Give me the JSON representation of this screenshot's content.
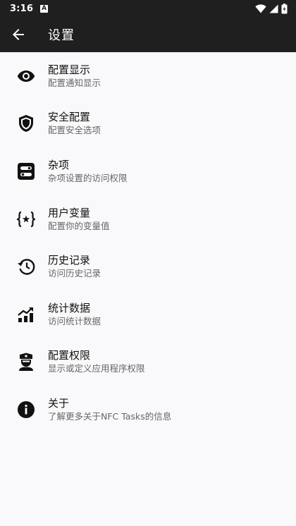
{
  "status_bar": {
    "time": "3:16",
    "notification_icon": "A"
  },
  "app_bar": {
    "title": "设置"
  },
  "settings_items": [
    {
      "icon": "eye-icon",
      "title": "配置显示",
      "subtitle": "配置通知显示"
    },
    {
      "icon": "shield-icon",
      "title": "安全配置",
      "subtitle": "配置安全选项"
    },
    {
      "icon": "toggle-icon",
      "title": "杂项",
      "subtitle": "杂项设置的访问权限"
    },
    {
      "icon": "variable-icon",
      "title": "用户变量",
      "subtitle": "配置你的变量值"
    },
    {
      "icon": "history-icon",
      "title": "历史记录",
      "subtitle": "访问历史记录"
    },
    {
      "icon": "stats-icon",
      "title": "统计数据",
      "subtitle": "访问统计数据"
    },
    {
      "icon": "police-icon",
      "title": "配置权限",
      "subtitle": "显示或定义应用程序权限"
    },
    {
      "icon": "info-icon",
      "title": "关于",
      "subtitle": "了解更多关于NFC Tasks的信息"
    }
  ]
}
